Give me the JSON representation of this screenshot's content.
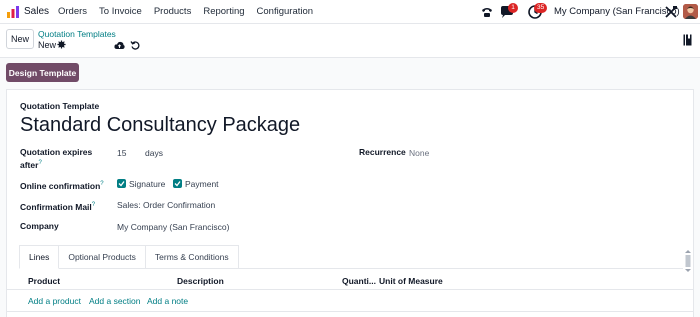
{
  "navbar": {
    "app_name": "Sales",
    "menu": [
      "Orders",
      "To Invoice",
      "Products",
      "Reporting",
      "Configuration"
    ],
    "messages_count": "1",
    "activities_count": "35",
    "company": "My Company (San Francisco)"
  },
  "control_panel": {
    "new_label": "New",
    "breadcrumb": "Quotation Templates",
    "record_name": "New"
  },
  "actions": {
    "design_template": "Design Template"
  },
  "form": {
    "title_label": "Quotation Template",
    "title": "Standard Consultancy Package",
    "expires_label": "Quotation expires after",
    "expires_value": "15",
    "expires_unit": "days",
    "recurrence_label": "Recurrence",
    "recurrence_value": "None",
    "online_confirmation_label": "Online confirmation",
    "signature_label": "Signature",
    "signature_checked": true,
    "payment_label": "Payment",
    "payment_checked": true,
    "confirmation_mail_label": "Confirmation Mail",
    "confirmation_mail_value": "Sales: Order Confirmation",
    "company_label": "Company",
    "company_value": "My Company (San Francisco)"
  },
  "notebook": {
    "tabs": [
      "Lines",
      "Optional Products",
      "Terms & Conditions"
    ],
    "active_tab": "Lines",
    "columns": {
      "product": "Product",
      "description": "Description",
      "quantity": "Quanti...",
      "uom": "Unit of Measure"
    },
    "add_links": [
      "Add a product",
      "Add a section",
      "Add a note"
    ]
  },
  "colors": {
    "accent": "#017e84",
    "brand": "#714b67",
    "badge": "#dc2626"
  }
}
